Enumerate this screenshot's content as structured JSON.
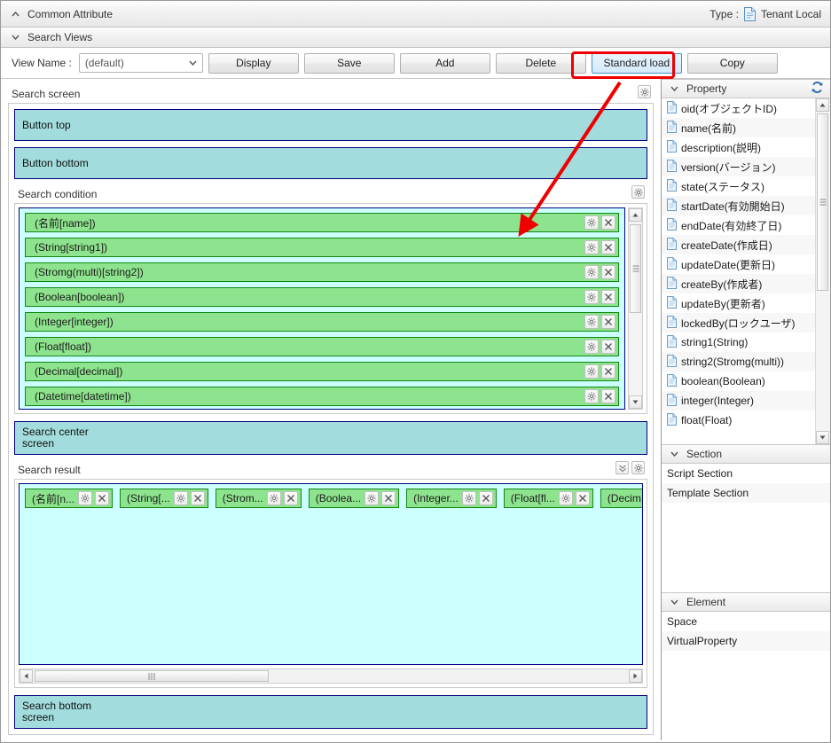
{
  "window": {
    "common_attribute_title": "Common Attribute",
    "type_label": "Type :",
    "type_value": "Tenant Local",
    "search_views_title": "Search Views"
  },
  "toolbar": {
    "view_name_label": "View Name :",
    "view_name_value": "(default)",
    "buttons": [
      {
        "label": "Display",
        "selected": false
      },
      {
        "label": "Save",
        "selected": false
      },
      {
        "label": "Add",
        "selected": false
      },
      {
        "label": "Delete",
        "selected": false
      },
      {
        "label": "Standard load",
        "selected": true
      },
      {
        "label": "Copy",
        "selected": false
      }
    ],
    "highlighted_button": "Standard load"
  },
  "search_screen": {
    "title": "Search screen",
    "button_top": "Button top",
    "button_bottom": "Button bottom",
    "search_condition_title": "Search condition",
    "conditions": [
      "(名前[name])",
      "(String[string1])",
      "(Stromg(multi)[string2])",
      "(Boolean[boolean])",
      "(Integer[integer])",
      "(Float[float])",
      "(Decimal[decimal])",
      "(Datetime[datetime])"
    ],
    "search_center_screen": "Search center\nscreen",
    "search_center_screen_l1": "Search center",
    "search_center_screen_l2": "screen",
    "search_result_title": "Search result",
    "result_columns": [
      "(名前[n...",
      "(String[...",
      "(Strom...",
      "(Boolea...",
      "(Integer...",
      "(Float[fl...",
      "(Decim..."
    ],
    "search_bottom_screen_l1": "Search bottom",
    "search_bottom_screen_l2": "screen"
  },
  "property_panel": {
    "title": "Property",
    "items": [
      "oid(オブジェクトID)",
      "name(名前)",
      "description(説明)",
      "version(バージョン)",
      "state(ステータス)",
      "startDate(有効開始日)",
      "endDate(有効終了日)",
      "createDate(作成日)",
      "updateDate(更新日)",
      "createBy(作成者)",
      "updateBy(更新者)",
      "lockedBy(ロックユーザ)",
      "string1(String)",
      "string2(Stromg(multi))",
      "boolean(Boolean)",
      "integer(Integer)",
      "float(Float)"
    ]
  },
  "section_panel": {
    "title": "Section",
    "items": [
      "Script Section",
      "Template Section"
    ]
  },
  "element_panel": {
    "title": "Element",
    "items": [
      "Space",
      "VirtualProperty"
    ]
  },
  "icons": {
    "collapse_up": "▲",
    "collapse_down": "▼",
    "chevron_down": "⌄",
    "gear": "gear-icon",
    "close_x": "close-icon",
    "refresh": "refresh-icon",
    "scroll_up": "▲",
    "scroll_down": "▼",
    "scroll_left": "◄",
    "scroll_right": "►",
    "double_chevron_down": "⌄⌄"
  },
  "colors": {
    "teal_band": "#a2dcdc",
    "cyan_panel": "#ccffff",
    "green_row": "#8ee48e",
    "green_border": "#118811",
    "navy_border": "#000080",
    "highlight_red": "#ee0000",
    "selected_button": "#d4eafb"
  },
  "annotation": {
    "arrow_color": "#ee0000",
    "arrow_from": "Standard load",
    "arrow_to": "(名前[name])"
  }
}
